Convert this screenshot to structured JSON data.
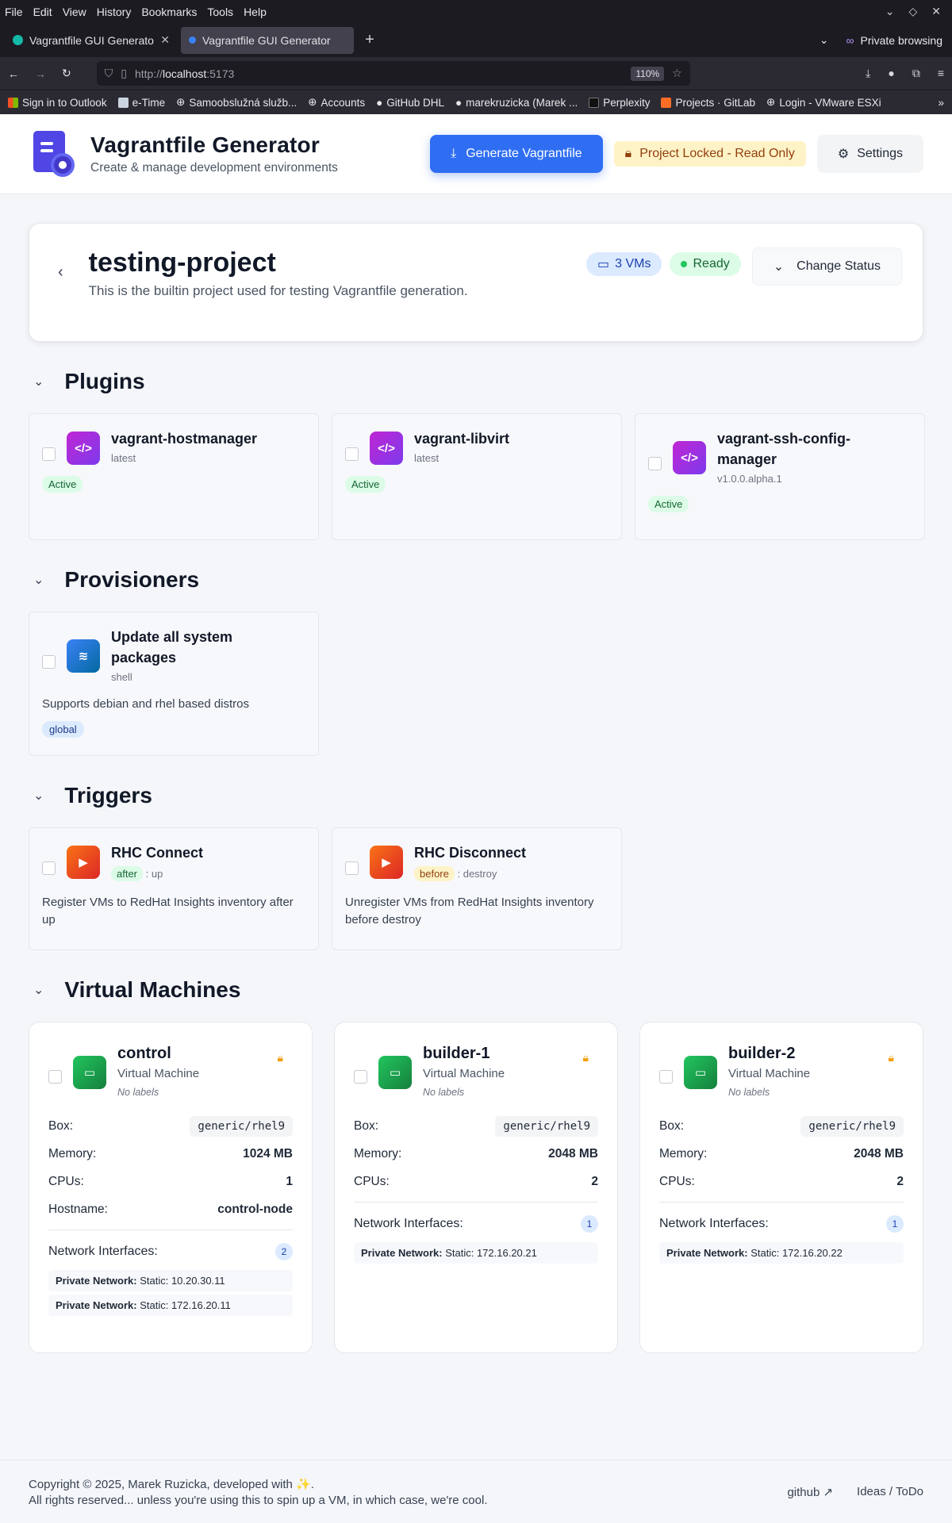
{
  "browser": {
    "menu": [
      "File",
      "Edit",
      "View",
      "History",
      "Bookmarks",
      "Tools",
      "Help"
    ],
    "tabs": [
      {
        "title": "Vagrantfile GUI Generator",
        "active": false
      },
      {
        "title": "Vagrantfile GUI Generator",
        "active": true
      }
    ],
    "private_label": "Private browsing",
    "url_host": "http://",
    "url_domain": "localhost",
    "url_port": ":5173",
    "zoom": "110%",
    "bookmarks": [
      "Sign in to Outlook",
      "e-Time",
      "Samoobslužná služb...",
      "Accounts",
      "GitHub DHL",
      "marekruzicka (Marek ...",
      "Perplexity",
      "Projects · GitLab",
      "Login - VMware ESXi"
    ]
  },
  "header": {
    "title": "Vagrantfile Generator",
    "subtitle": "Create & manage development environments",
    "generate_label": "Generate Vagrantfile",
    "locked_label": "Project Locked - Read Only",
    "settings_label": "Settings"
  },
  "project": {
    "name": "testing-project",
    "description": "This is the builtin project used for testing Vagrantfile generation.",
    "vms_badge": "3 VMs",
    "status": "Ready",
    "change_status_label": "Change Status"
  },
  "sections": {
    "plugins": "Plugins",
    "provisioners": "Provisioners",
    "triggers": "Triggers",
    "vms": "Virtual Machines"
  },
  "plugins": [
    {
      "name": "vagrant-hostmanager",
      "version": "latest",
      "status": "Active"
    },
    {
      "name": "vagrant-libvirt",
      "version": "latest",
      "status": "Active"
    },
    {
      "name": "vagrant-ssh-config-manager",
      "version": "v1.0.0.alpha.1",
      "status": "Active"
    }
  ],
  "provisioners": [
    {
      "name": "Update all system packages",
      "type": "shell",
      "description": "Supports debian and rhel based distros",
      "scope": "global"
    }
  ],
  "triggers": [
    {
      "name": "RHC Connect",
      "when": "after",
      "action": ": up",
      "description": "Register VMs to RedHat Insights inventory after up"
    },
    {
      "name": "RHC Disconnect",
      "when": "before",
      "action": ": destroy",
      "description": "Unregister VMs from RedHat Insights inventory before destroy"
    }
  ],
  "vm_labels": {
    "type": "Virtual Machine",
    "no_labels": "No labels",
    "box": "Box:",
    "memory": "Memory:",
    "cpus": "CPUs:",
    "hostname": "Hostname:",
    "network": "Network Interfaces:"
  },
  "vms": [
    {
      "name": "control",
      "box": "generic/rhel9",
      "memory": "1024 MB",
      "cpus": "1",
      "hostname": "control-node",
      "net_count": "2",
      "nets": [
        {
          "label": "Private Network:",
          "value": "Static: 10.20.30.11"
        },
        {
          "label": "Private Network:",
          "value": "Static: 172.16.20.11"
        }
      ]
    },
    {
      "name": "builder-1",
      "box": "generic/rhel9",
      "memory": "2048 MB",
      "cpus": "2",
      "net_count": "1",
      "nets": [
        {
          "label": "Private Network:",
          "value": "Static: 172.16.20.21"
        }
      ]
    },
    {
      "name": "builder-2",
      "box": "generic/rhel9",
      "memory": "2048 MB",
      "cpus": "2",
      "net_count": "1",
      "nets": [
        {
          "label": "Private Network:",
          "value": "Static: 172.16.20.22"
        }
      ]
    }
  ],
  "footer": {
    "line1": "Copyright © 2025, Marek Ruzicka, developed with ✨.",
    "line2": "All rights reserved... unless you're using this to spin up a VM, in which case, we're cool.",
    "github": "github ↗",
    "ideas": "Ideas / ToDo"
  }
}
